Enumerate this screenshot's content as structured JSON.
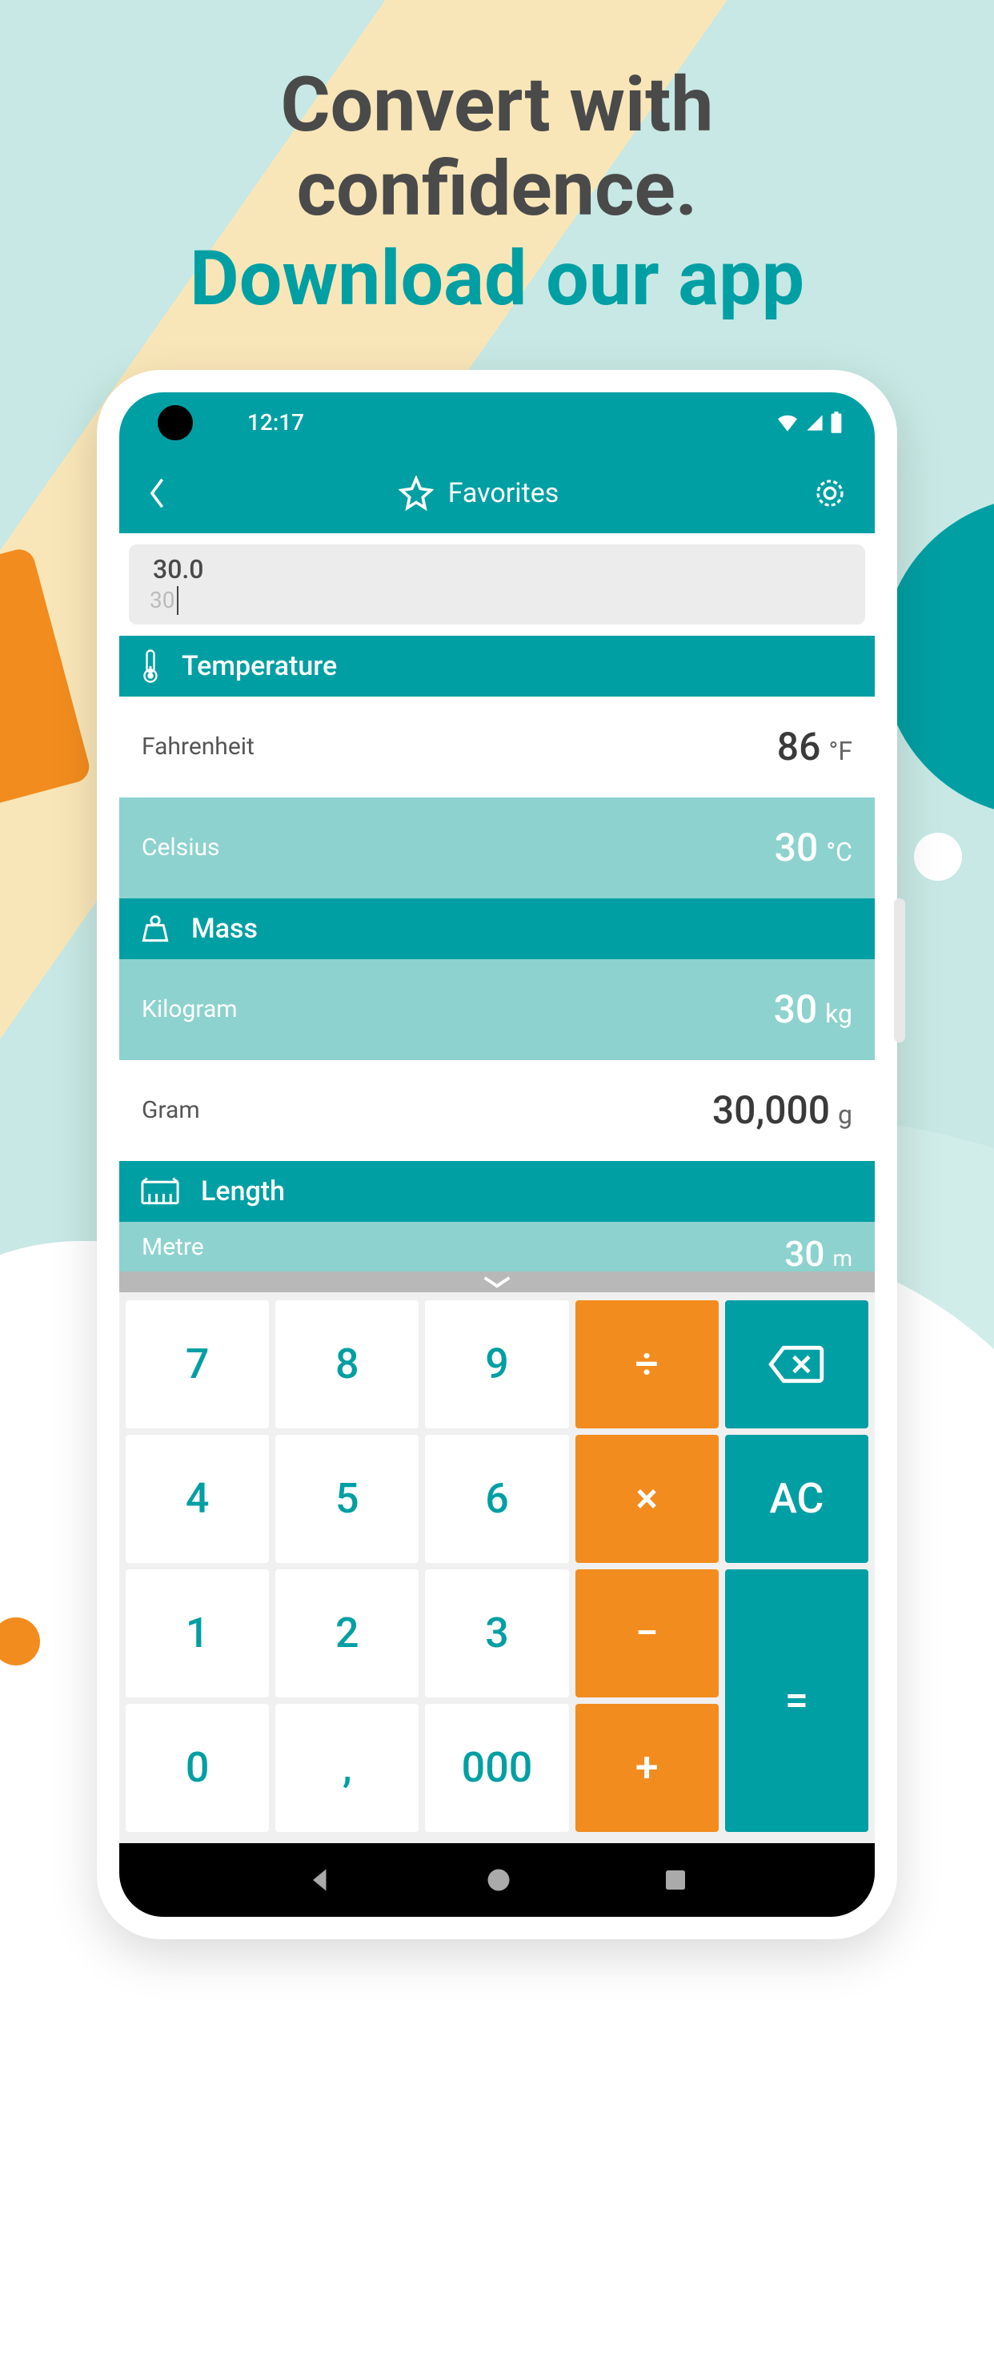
{
  "hero": {
    "line1": "Convert with",
    "line2": "confidence.",
    "line3": "Download our app"
  },
  "status": {
    "time": "12:17"
  },
  "appbar": {
    "title": "Favorites"
  },
  "input": {
    "placeholder": "30",
    "display_value": "30.0"
  },
  "sections": {
    "temperature": {
      "title": "Temperature",
      "rows": [
        {
          "label": "Fahrenheit",
          "value": "86",
          "unit": "°F"
        },
        {
          "label": "Celsius",
          "value": "30",
          "unit": "°C"
        }
      ]
    },
    "mass": {
      "title": "Mass",
      "rows": [
        {
          "label": "Kilogram",
          "value": "30",
          "unit": "kg"
        },
        {
          "label": "Gram",
          "value": "30,000",
          "unit": "g"
        }
      ]
    },
    "length": {
      "title": "Length",
      "rows": [
        {
          "label": "Metre",
          "value": "30",
          "unit": "m"
        }
      ]
    }
  },
  "keypad": {
    "keys": [
      "7",
      "8",
      "9",
      "÷",
      "⌫",
      "4",
      "5",
      "6",
      "×",
      "AC",
      "1",
      "2",
      "3",
      "−",
      "=",
      "0",
      ",",
      "000",
      "+"
    ]
  }
}
